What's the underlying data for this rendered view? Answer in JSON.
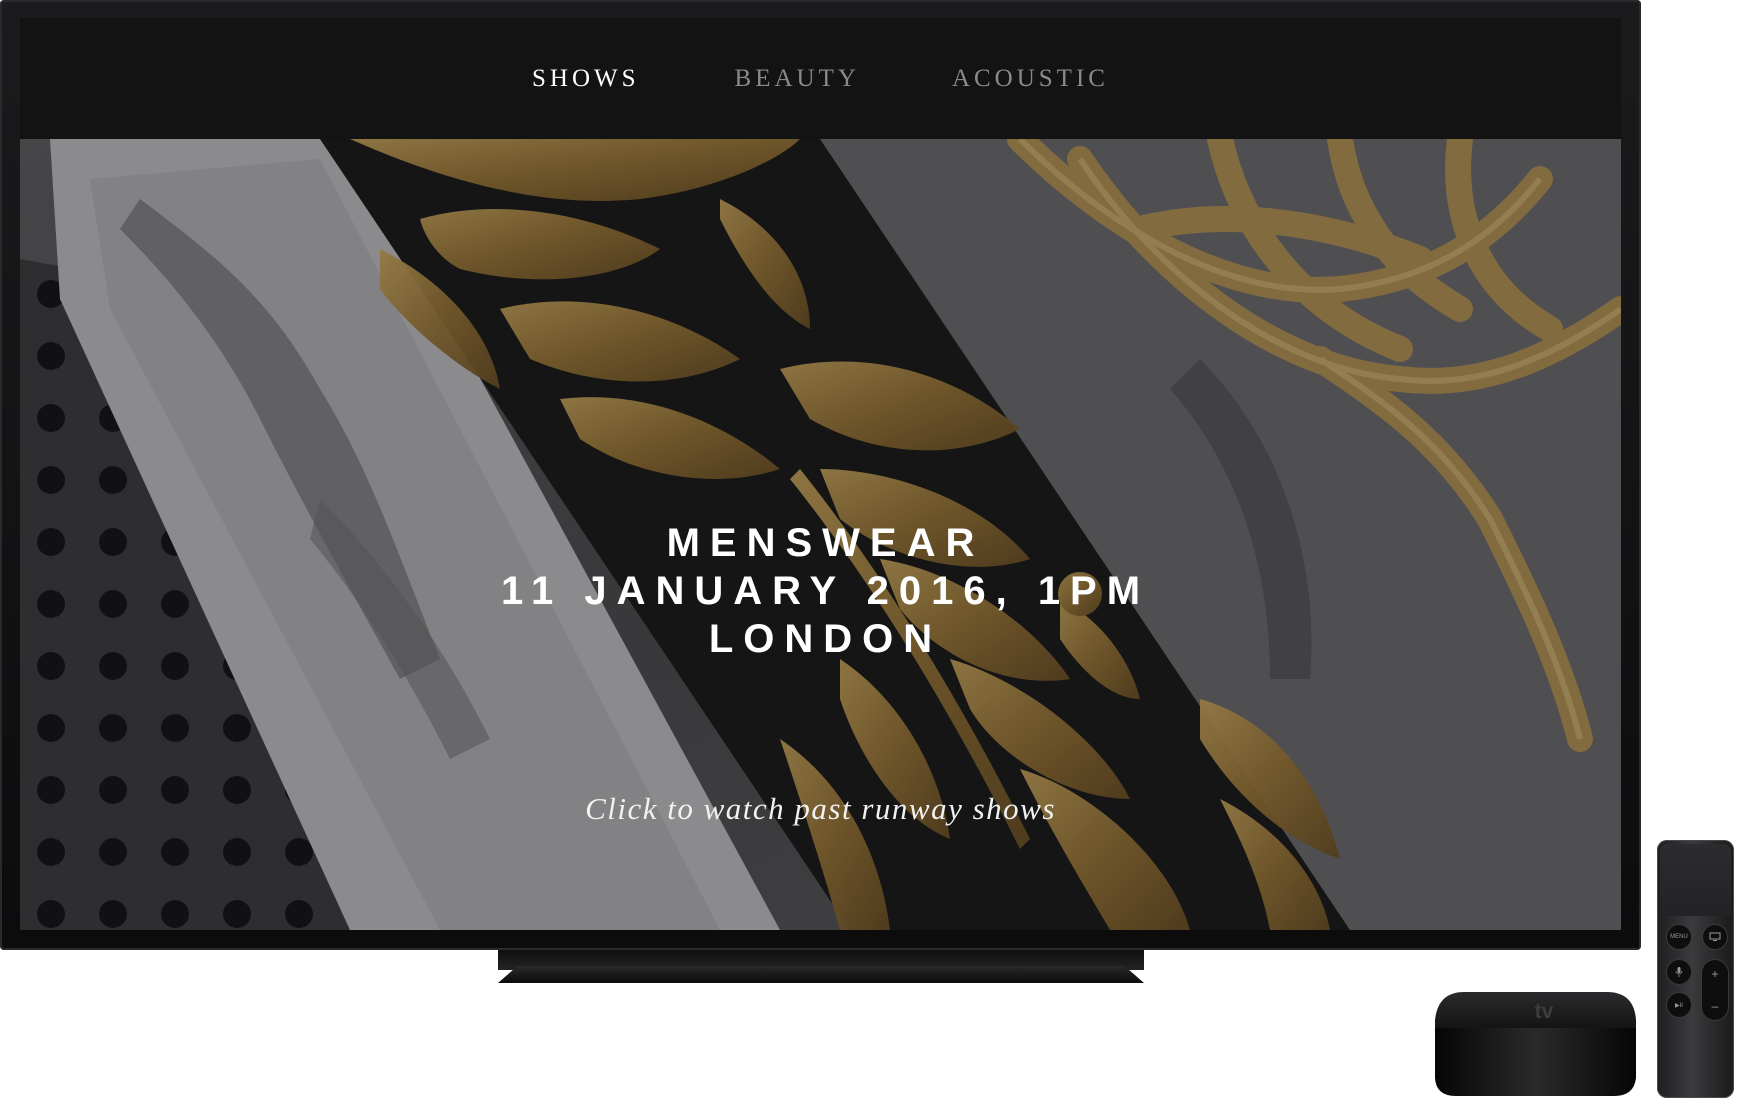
{
  "nav": {
    "tabs": [
      {
        "label": "SHOWS",
        "active": true
      },
      {
        "label": "BEAUTY",
        "active": false
      },
      {
        "label": "ACOUSTIC",
        "active": false
      }
    ]
  },
  "hero": {
    "event_lines": [
      "MENSWEAR",
      "11 JANUARY 2016, 1PM",
      "LONDON"
    ],
    "cta_label": "Click to watch past runway shows"
  },
  "remote": {
    "menu_label": "MENU",
    "play_pause_label": "▶II",
    "volume_up": "+",
    "volume_down": "–"
  },
  "device": {
    "logo_text": " tv"
  },
  "colors": {
    "nav_background": "#131314",
    "nav_active": "#ffffff",
    "nav_inactive": "#8a8a8a",
    "gold_embroidery": "#b08a4a"
  }
}
